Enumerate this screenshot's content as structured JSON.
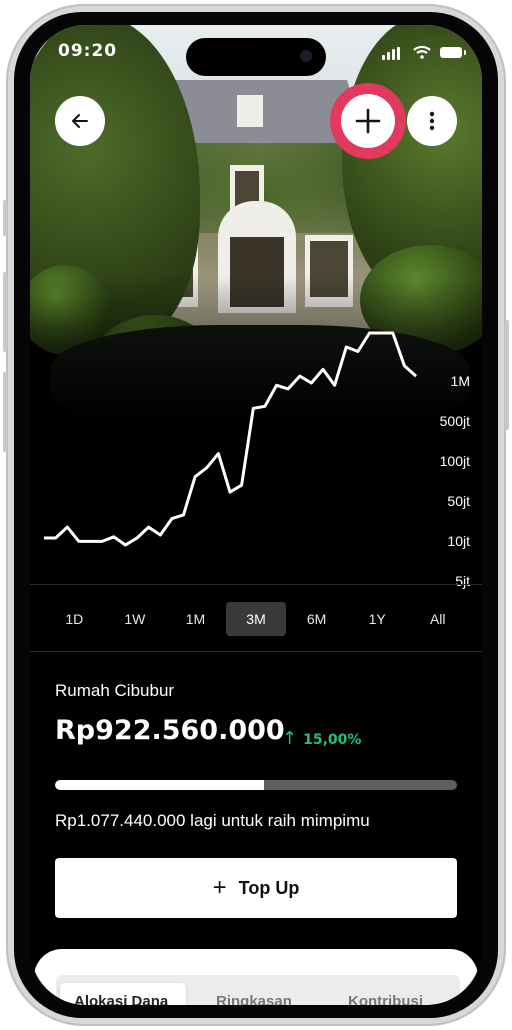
{
  "status_bar": {
    "time": "09:20"
  },
  "header": {
    "back_icon": "arrow-left-icon",
    "add_icon": "plus-icon",
    "more_icon": "more-vertical-icon",
    "accent": "#e4395f"
  },
  "chart_data": {
    "type": "line",
    "y_scale": "log",
    "y_ticks": [
      "1M",
      "500jt",
      "100jt",
      "50jt",
      "10jt",
      "5jt"
    ],
    "values_note_units": "Rp",
    "series": [
      {
        "values": [
          6000000,
          6000000,
          8000000,
          5500000,
          5500000,
          5500000,
          6200000,
          5000000,
          6000000,
          8000000,
          6500000,
          10000000,
          11000000,
          30000000,
          38000000,
          55000000,
          20000000,
          24000000,
          180000000,
          190000000,
          330000000,
          300000000,
          420000000,
          350000000,
          500000000,
          330000000,
          900000000,
          800000000,
          1300000000,
          1300000000,
          1300000000,
          550000000,
          420000000
        ]
      }
    ],
    "line_color": "#ffffff"
  },
  "ranges": {
    "items": [
      "1D",
      "1W",
      "1M",
      "3M",
      "6M",
      "1Y",
      "All"
    ],
    "selected": "3M"
  },
  "goal": {
    "name": "Rumah Cibubur",
    "amount": "Rp922.560.000",
    "change": "15,00%",
    "change_color": "#22c07a",
    "progress": 0.5211,
    "remaining": "Rp1.077.440.000 lagi untuk raih mimpimu"
  },
  "topup": {
    "label": "Top Up"
  },
  "tabs": {
    "items": [
      "Alokasi Dana",
      "Ringkasan",
      "Kontribusi"
    ],
    "selected": "Alokasi Dana"
  }
}
